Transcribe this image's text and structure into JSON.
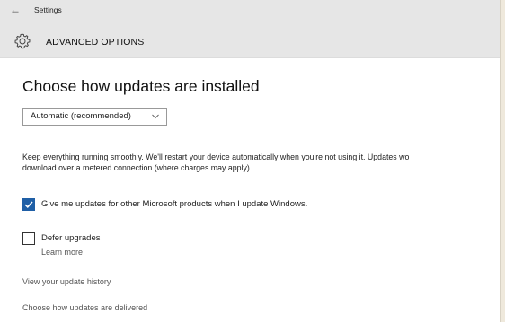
{
  "window": {
    "title": "Settings",
    "back_glyph": "←"
  },
  "header": {
    "icon": "gear-icon",
    "title": "ADVANCED OPTIONS"
  },
  "main": {
    "page_title": "Choose how updates are installed",
    "install_mode": {
      "selected": "Automatic (recommended)"
    },
    "description_lines": [
      "Keep everything running smoothly. We'll restart your device automatically when you're not using it. Updates wo",
      "download over a metered connection (where charges may apply)."
    ],
    "microsoft_updates": {
      "label": "Give me updates for other Microsoft products when I update Windows.",
      "checked": true
    },
    "defer_upgrades": {
      "label": "Defer upgrades",
      "checked": false,
      "learn_more": "Learn more"
    },
    "links": {
      "history": "View your update history",
      "delivery": "Choose how updates are delivered"
    }
  },
  "colors": {
    "accent": "#1f5fa6",
    "header_bg": "#e6e6e6",
    "background": "#ffffff"
  }
}
